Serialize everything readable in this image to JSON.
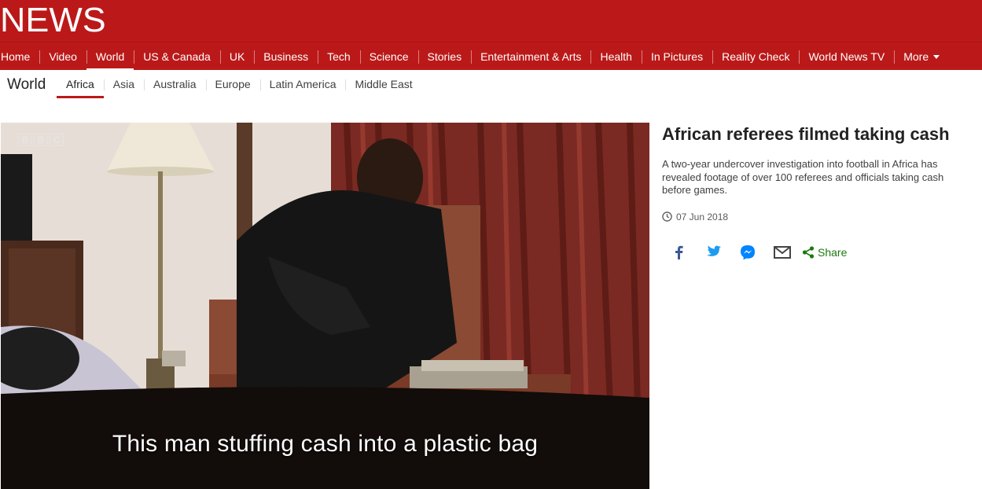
{
  "brand": {
    "logo_text": "NEWS"
  },
  "nav": {
    "items": [
      {
        "label": "Home"
      },
      {
        "label": "Video"
      },
      {
        "label": "World"
      },
      {
        "label": "US & Canada"
      },
      {
        "label": "UK"
      },
      {
        "label": "Business"
      },
      {
        "label": "Tech"
      },
      {
        "label": "Science"
      },
      {
        "label": "Stories"
      },
      {
        "label": "Entertainment & Arts"
      },
      {
        "label": "Health"
      },
      {
        "label": "In Pictures"
      },
      {
        "label": "Reality Check"
      },
      {
        "label": "World News TV"
      },
      {
        "label": "More"
      }
    ],
    "active": "World"
  },
  "subnav": {
    "title": "World",
    "items": [
      {
        "label": "Africa"
      },
      {
        "label": "Asia"
      },
      {
        "label": "Australia"
      },
      {
        "label": "Europe"
      },
      {
        "label": "Latin America"
      },
      {
        "label": "Middle East"
      }
    ],
    "active": "Africa"
  },
  "video": {
    "watermark": [
      "B",
      "B",
      "C"
    ],
    "caption": "This man stuffing cash into a plastic bag"
  },
  "story": {
    "headline": "African referees filmed taking cash",
    "summary": "A two-year undercover investigation into football in Africa has revealed footage of over 100 referees and officials taking cash before games.",
    "date": "07 Jun 2018",
    "share_label": "Share",
    "share_icons": [
      "facebook-icon",
      "twitter-icon",
      "messenger-icon",
      "email-icon",
      "share-icon"
    ]
  },
  "colors": {
    "brand_red": "#bb1919",
    "share_green": "#1c7a0f",
    "social_blue": "#3b5998"
  }
}
